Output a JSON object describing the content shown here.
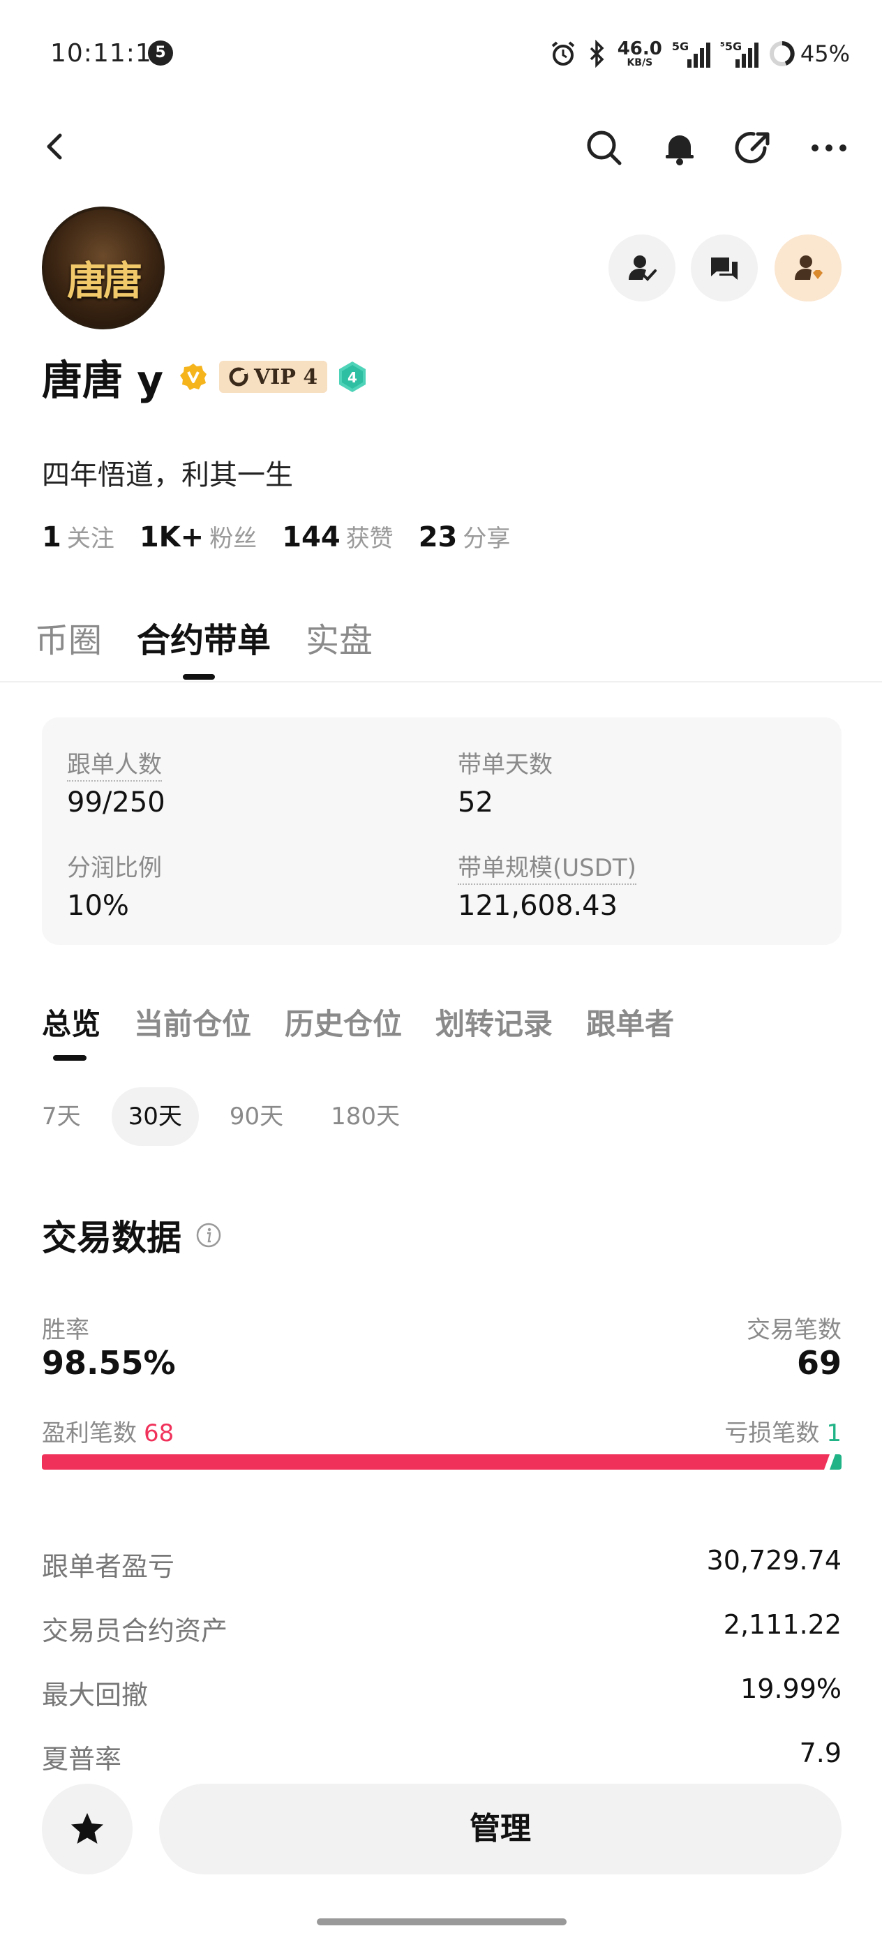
{
  "status_bar": {
    "time": "10:11:15",
    "notification_count": "5",
    "net_speed_value": "46.0",
    "net_speed_unit": "KB/S",
    "signal1_label": "5G",
    "signal2_label": "⁵5G",
    "battery": "45%"
  },
  "nav": {
    "icons": [
      "back-icon",
      "search-icon",
      "bell-icon",
      "share-icon",
      "more-icon"
    ]
  },
  "profile": {
    "avatar_text": "唐唐",
    "name": "唐唐 y",
    "vip_label": "VIP 4",
    "level": "4",
    "bio": "四年悟道，利其一生",
    "stats": [
      {
        "num": "1",
        "label": "关注"
      },
      {
        "num": "1K+",
        "label": "粉丝"
      },
      {
        "num": "144",
        "label": "获赞"
      },
      {
        "num": "23",
        "label": "分享"
      }
    ]
  },
  "main_tabs": [
    {
      "label": "币圈"
    },
    {
      "label": "合约带单"
    },
    {
      "label": "实盘"
    }
  ],
  "info_card": {
    "followers_label": "跟单人数",
    "followers_value": "99/250",
    "days_label": "带单天数",
    "days_value": "52",
    "profit_share_label": "分润比例",
    "profit_share_value": "10%",
    "scale_label": "带单规模(USDT)",
    "scale_value": "121,608.43"
  },
  "sub_tabs": [
    {
      "label": "总览"
    },
    {
      "label": "当前仓位"
    },
    {
      "label": "历史仓位"
    },
    {
      "label": "划转记录"
    },
    {
      "label": "跟单者"
    }
  ],
  "periods": [
    {
      "label": "7天"
    },
    {
      "label": "30天"
    },
    {
      "label": "90天"
    },
    {
      "label": "180天"
    }
  ],
  "trading_data": {
    "title": "交易数据",
    "win_rate_label": "胜率",
    "win_rate_value": "98.55%",
    "trade_count_label": "交易笔数",
    "trade_count_value": "69",
    "profit_trades_label": "盈利笔数",
    "profit_trades_value": "68",
    "loss_trades_label": "亏损笔数",
    "loss_trades_value": "1",
    "profit_ratio": 0.9855,
    "colors": {
      "profit": "#f0325b",
      "loss": "#1fb386"
    },
    "metrics": [
      {
        "label": "跟单者盈亏",
        "value": "30,729.74"
      },
      {
        "label": "交易员合约资产",
        "value": "2,111.22"
      },
      {
        "label": "最大回撤",
        "value": "19.99%"
      },
      {
        "label": "夏普率",
        "value": "7.9"
      }
    ]
  },
  "bottom": {
    "manage_label": "管理"
  }
}
